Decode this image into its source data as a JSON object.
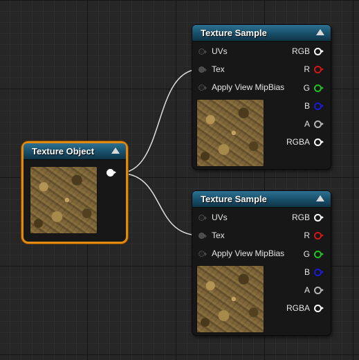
{
  "texture_object": {
    "title": "Texture Object"
  },
  "texture_samples": [
    {
      "title": "Texture Sample",
      "inputs": [
        "UVs",
        "Tex",
        "Apply View MipBias"
      ],
      "outputs": [
        "RGB",
        "R",
        "G",
        "B",
        "A",
        "RGBA"
      ]
    },
    {
      "title": "Texture Sample",
      "inputs": [
        "UVs",
        "Tex",
        "Apply View MipBias"
      ],
      "outputs": [
        "RGB",
        "R",
        "G",
        "B",
        "A",
        "RGBA"
      ]
    }
  ],
  "colors": {
    "header_blue": "#1b5470",
    "selection_orange": "#e08a12",
    "pin_white": "#ffffff",
    "pin_red": "#d01818",
    "pin_green": "#20c020",
    "pin_blue": "#1a1ad8",
    "pin_alpha": "#b4b4b4",
    "wire": "#e0e0e0"
  },
  "icons": [
    "collapse-arrow-icon",
    "input-pin-icon",
    "output-pin-icon"
  ]
}
